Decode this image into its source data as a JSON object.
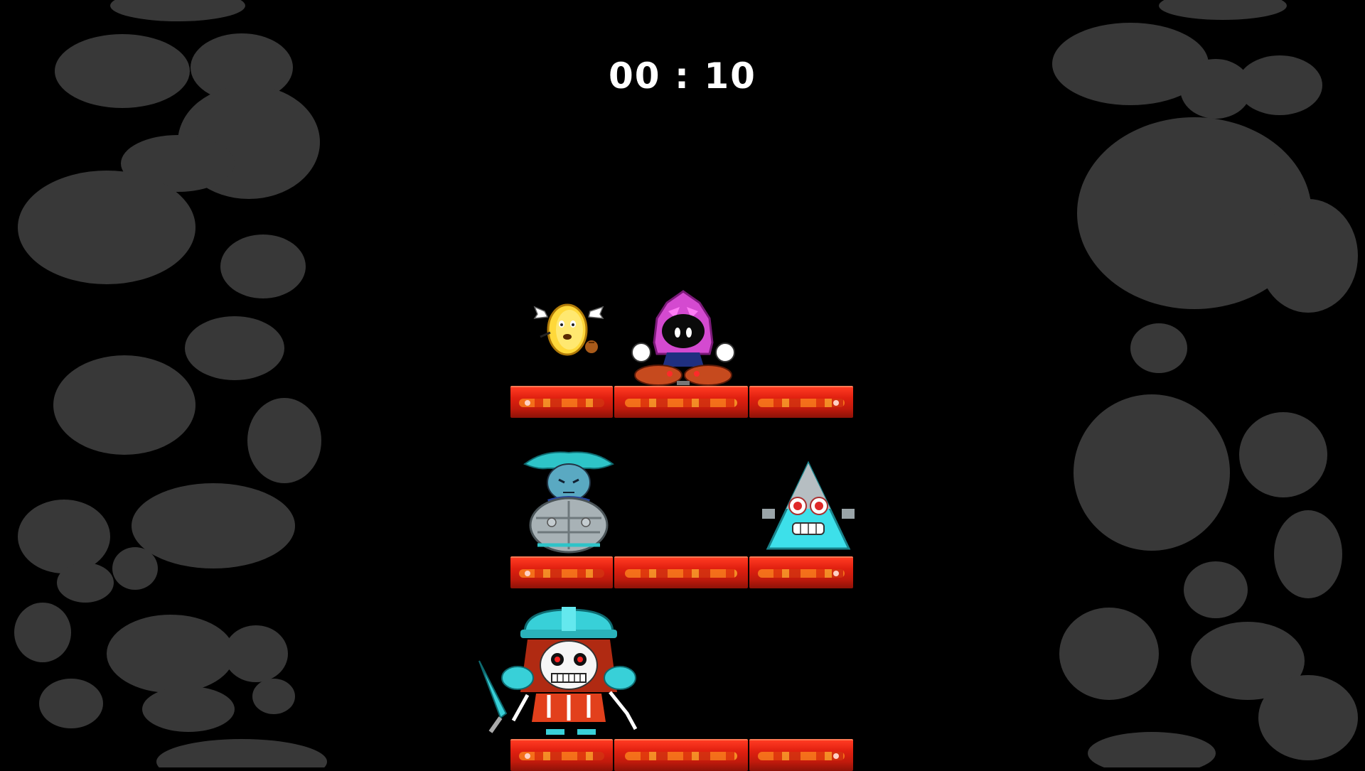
{
  "hud": {
    "timer": "00 : 10"
  },
  "colors": {
    "background": "#000000",
    "rock": "#383838",
    "platform": "#e02010",
    "timer_text": "#ffffff"
  },
  "scene": {
    "platforms": [
      "top-platform",
      "middle-platform",
      "bottom-platform"
    ],
    "characters": [
      {
        "name": "winged-coin-character",
        "tier": "top"
      },
      {
        "name": "pink-hooded-character",
        "tier": "top"
      },
      {
        "name": "armored-knight-character",
        "tier": "middle"
      },
      {
        "name": "triangle-character",
        "tier": "middle"
      },
      {
        "name": "skeleton-helmet-character",
        "tier": "bottom"
      }
    ]
  }
}
